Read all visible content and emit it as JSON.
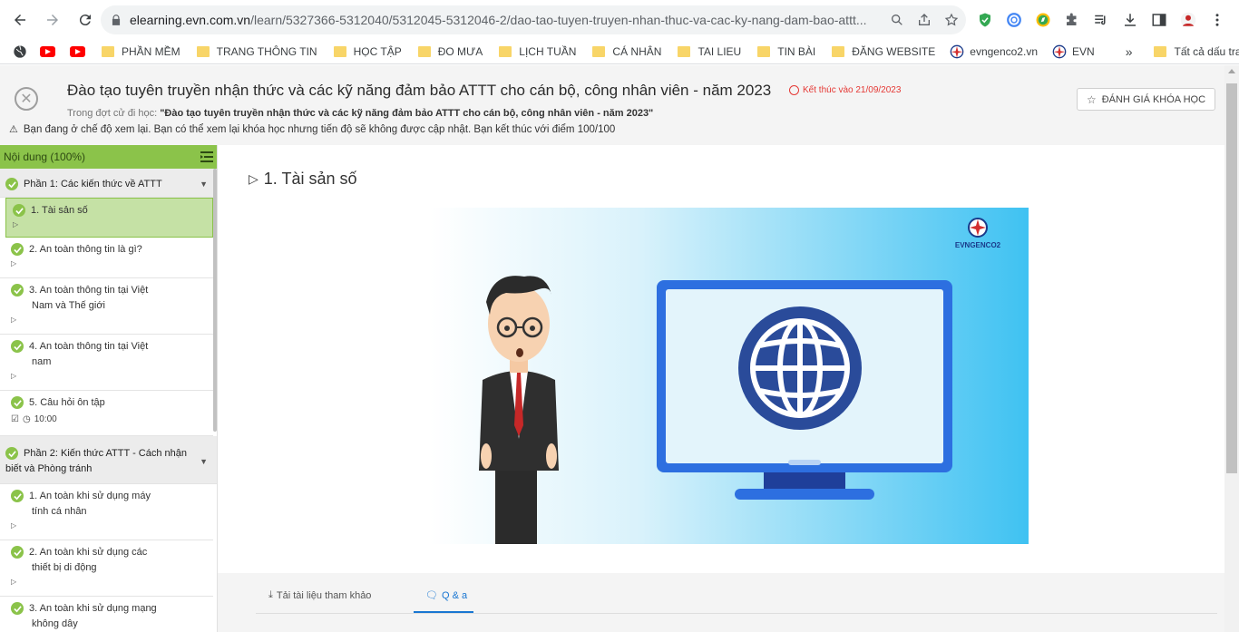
{
  "browser": {
    "url_host": "elearning.evn.com.vn",
    "url_path": "/learn/5327366-5312040/5312045-5312046-2/dao-tao-tuyen-truyen-nhan-thuc-va-cac-ky-nang-dam-bao-attt...",
    "bookmarks": [
      {
        "label": "PHẦN MỀM"
      },
      {
        "label": "TRANG THÔNG TIN"
      },
      {
        "label": "HỌC TẬP"
      },
      {
        "label": "ĐO MƯA"
      },
      {
        "label": "LỊCH TUẦN"
      },
      {
        "label": "CÁ NHÂN"
      },
      {
        "label": "TAI LIEU"
      },
      {
        "label": "TIN BÀI"
      },
      {
        "label": "ĐĂNG WEBSITE"
      },
      {
        "label": "evngenco2.vn"
      },
      {
        "label": "EVN"
      }
    ],
    "more_bookmarks": "»",
    "all_bookmarks": "Tất cả dấu trang"
  },
  "header": {
    "title": "Đào tạo tuyên truyền nhận thức và các kỹ năng đảm bảo ATTT cho cán bộ, công nhân viên - năm 2023",
    "deadline": "Kết thúc vào 21/09/2023",
    "rate_button": "ĐÁNH GIÁ KHÓA HỌC",
    "sub_prefix": "Trong đợt cử đi học: ",
    "sub_value": "\"Đào tạo tuyên truyền nhận thức và các kỹ năng đảm bảo ATTT cho cán bộ, công nhân viên - năm 2023\"",
    "review_note": "Bạn đang ở chế độ xem lại. Bạn có thể xem lại khóa học nhưng tiến độ sẽ không được cập nhật. Bạn kết thúc với điểm 100/100"
  },
  "sidebar": {
    "title": "Nội dung (100%)",
    "section1": "Phần 1: Các kiến thức về ATTT",
    "section1_lessons": [
      {
        "line1": "1. Tài sản số",
        "line2": ""
      },
      {
        "line1": "2. An toàn thông tin là gì?",
        "line2": ""
      },
      {
        "line1": "3. An toàn thông tin tại Việt",
        "line2": "Nam và Thế giới"
      },
      {
        "line1": "4. An toàn thông tin tại Việt",
        "line2": "nam"
      },
      {
        "line1": "5. Câu hỏi ôn tập",
        "line2": "",
        "time": "10:00"
      }
    ],
    "section2_line1": "Phần 2: Kiến thức ATTT - Cách nhận",
    "section2_line2": "biết và Phòng tránh",
    "section2_lessons": [
      {
        "line1": "1. An toàn khi sử dụng máy",
        "line2": "tính cá nhân"
      },
      {
        "line1": "2. An toàn khi sử dụng các",
        "line2": "thiết bị di động"
      },
      {
        "line1": "3. An toàn khi sử dụng mạng",
        "line2": "không dây"
      }
    ]
  },
  "main": {
    "lesson_title": "1. Tài sản số",
    "video_logo_text": "EVNGENCO2",
    "tab_docs": "Tải tài liệu tham khảo",
    "tab_qa": "Q & a"
  },
  "colors": {
    "accent_green": "#8bc34a",
    "active_lesson_bg": "#c5e1a5",
    "deadline_red": "#e53935",
    "tab_blue": "#1976d2"
  }
}
